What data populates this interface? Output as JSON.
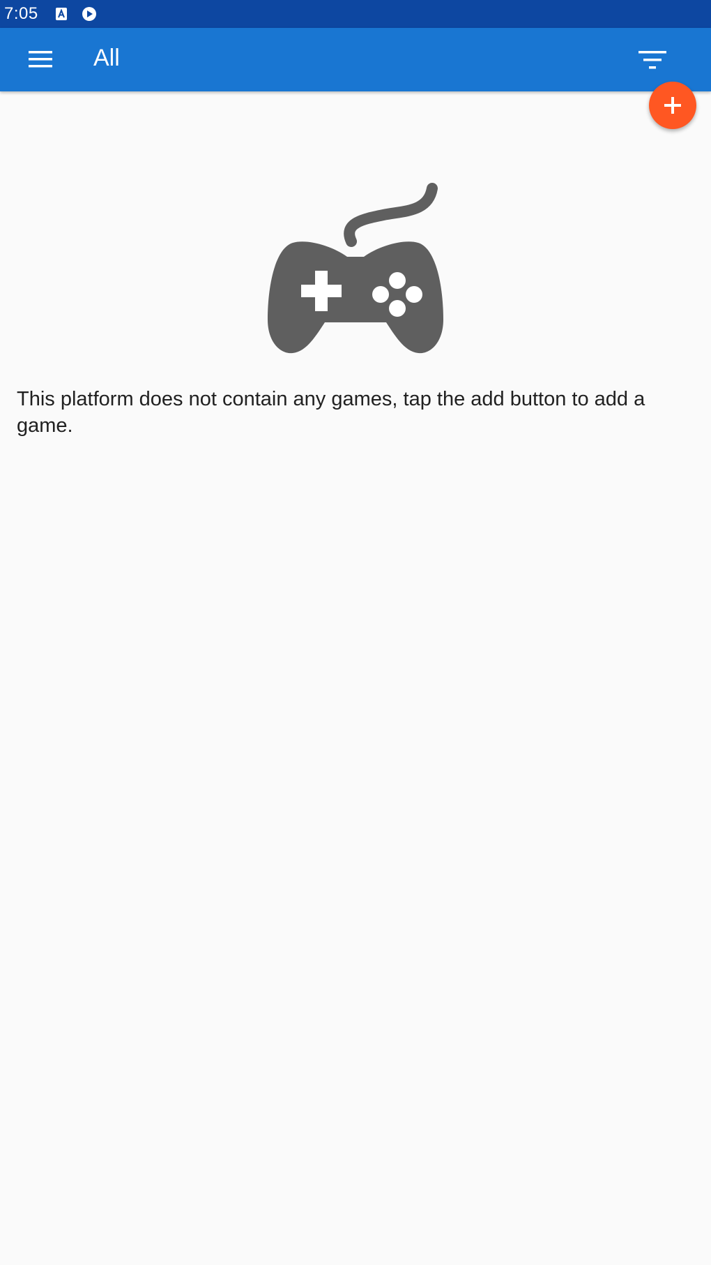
{
  "status_bar": {
    "time": "7:05",
    "icons": [
      "notification-a-icon",
      "play-badge-icon"
    ]
  },
  "app_bar": {
    "title": "All",
    "menu_icon": "menu-icon",
    "filter_icon": "filter-icon",
    "color": "#1976d2"
  },
  "fab": {
    "icon": "plus-icon",
    "color": "#ff5722"
  },
  "empty_state": {
    "icon": "gamepad-icon",
    "message": "This platform does not contain any games, tap the add button to add a game."
  },
  "colors": {
    "status_bar": "#0d47a1",
    "background": "#fafafa",
    "icon_gray": "#5f5f5f"
  }
}
